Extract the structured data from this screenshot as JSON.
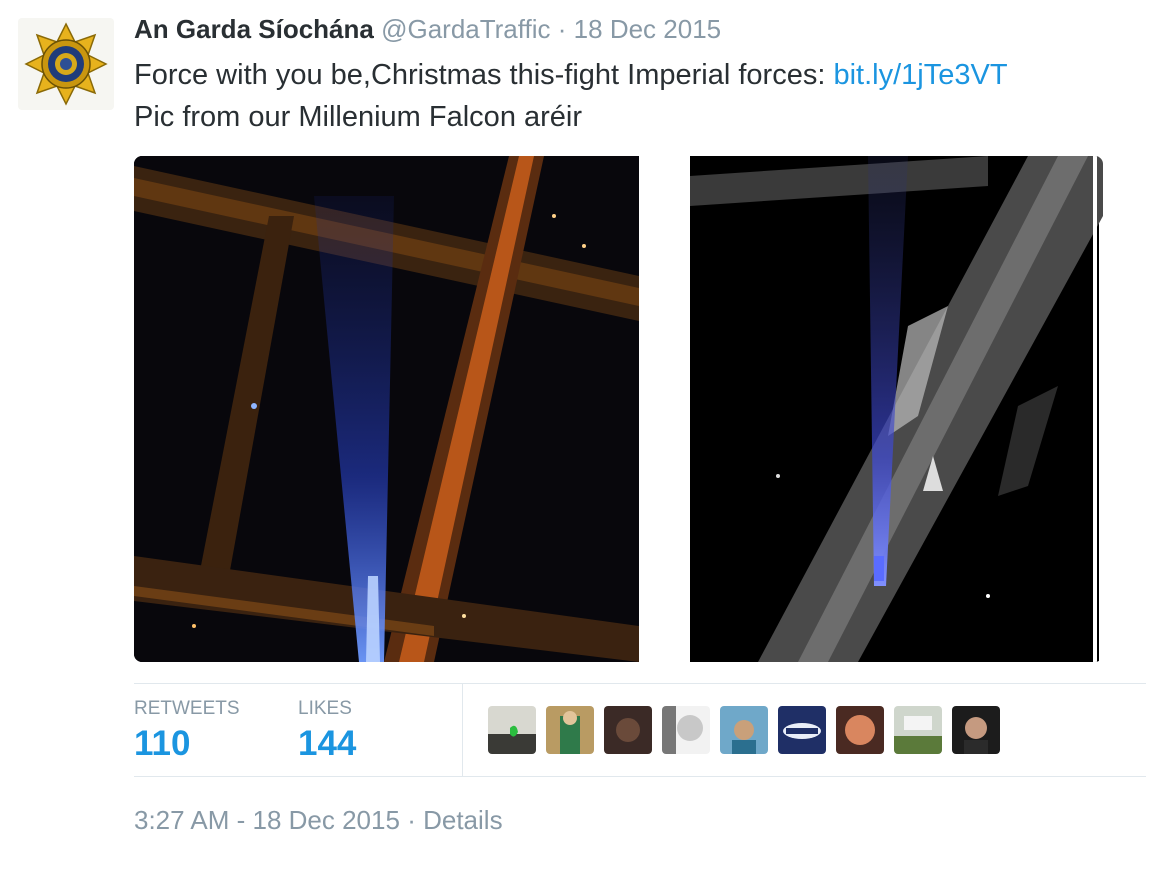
{
  "tweet": {
    "author_name": "An Garda Síochána",
    "handle": "@GardaTraffic",
    "separator": "·",
    "date": "18 Dec 2015",
    "text_part1": "Force with you be,Christmas this-fight Imperial forces: ",
    "link": "bit.ly/1jTe3VT",
    "text_line2": "Pic from our Millenium Falcon aréir"
  },
  "stats": {
    "retweets_label": "RETWEETS",
    "retweets_value": "110",
    "likes_label": "LIKES",
    "likes_value": "144"
  },
  "footer": {
    "timestamp": "3:27 AM - 18 Dec 2015",
    "separator": "·",
    "details_label": "Details"
  },
  "colors": {
    "link": "#1b95e0",
    "muted": "#8899a6",
    "text": "#292f33",
    "divider": "#e1e8ed"
  }
}
